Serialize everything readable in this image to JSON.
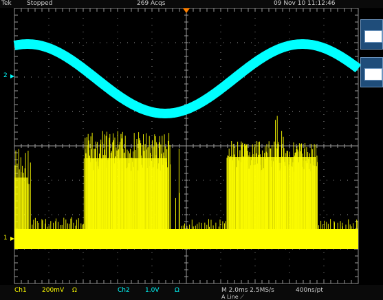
{
  "header": {
    "brand": "Tek",
    "state": "Stopped",
    "acquisitions": "269 Acqs",
    "datetime": "09 Nov 10 11:12:46"
  },
  "markers": {
    "ch2": "2",
    "ch1": "1"
  },
  "footer": {
    "ch1_label": "Ch1",
    "ch1_scale": "200mV",
    "ch1_coupling": "Ω",
    "ch2_label": "Ch2",
    "ch2_scale": "1.0V",
    "ch2_coupling": "Ω",
    "timebase": "M 2.0ms 2.5MS/s",
    "resolution": "400ns/pt",
    "trigger": "A  Line  ⟋"
  },
  "colors": {
    "ch1": "#ffff00",
    "ch2": "#00ffff",
    "trigger_marker": "#ff8000",
    "grid": "#9a9a9a",
    "menu_button": "#1f4d7a"
  },
  "icons": {
    "trigger_position": "trigger-position-marker-icon",
    "ch2_ground": "ch2-ground-marker-icon",
    "ch1_ground": "ch1-ground-marker-icon"
  }
}
